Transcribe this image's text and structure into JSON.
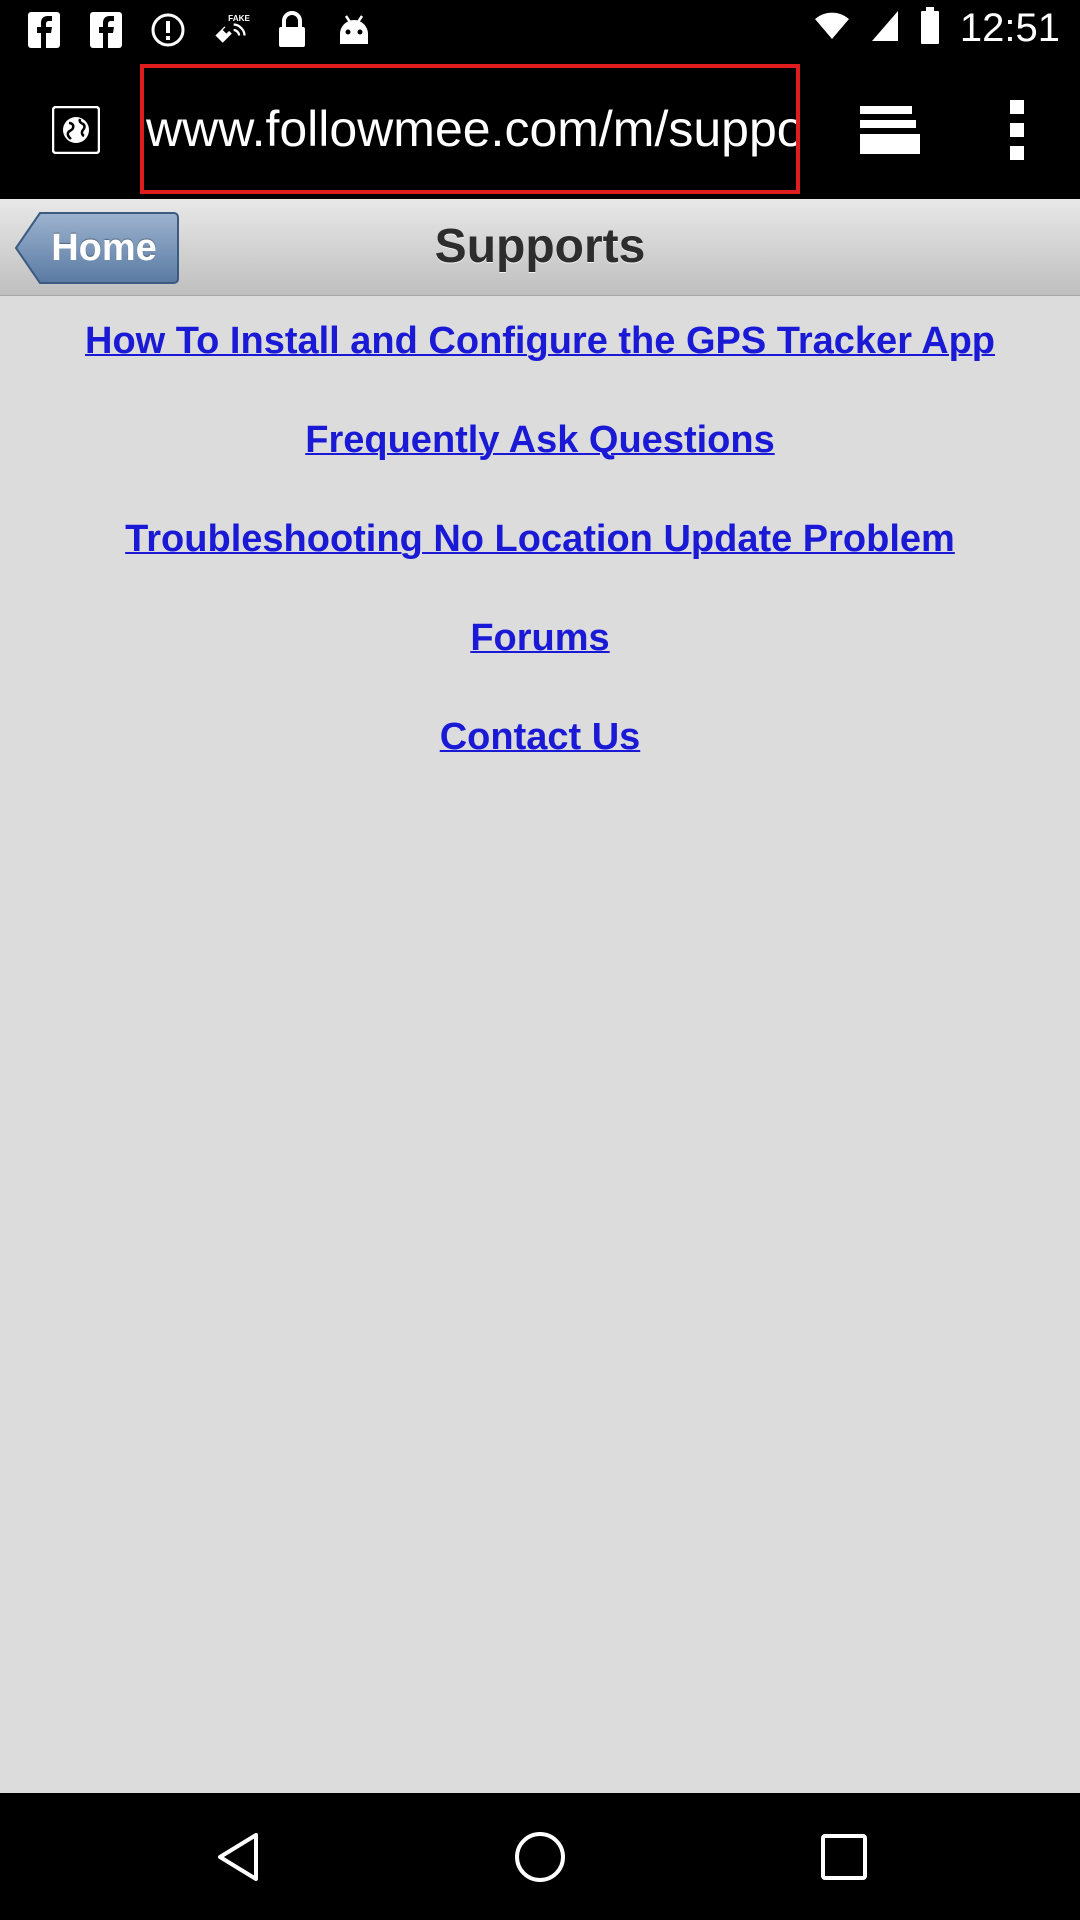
{
  "status_bar": {
    "time": "12:51",
    "left_icons": [
      "facebook-icon",
      "facebook-icon",
      "alert-icon",
      "fake-gps-icon",
      "lock-icon",
      "android-icon"
    ],
    "right_icons": [
      "wifi-icon",
      "signal-icon",
      "battery-icon"
    ]
  },
  "browser": {
    "url": "www.followmee.com/m/suppor"
  },
  "header": {
    "home_label": "Home",
    "title": "Supports"
  },
  "links": [
    "How To Install and Configure the GPS Tracker App",
    "Frequently Ask Questions",
    "Troubleshooting No Location Update Problem",
    "Forums",
    "Contact Us"
  ],
  "colors": {
    "link": "#1a1ad6",
    "highlight_border": "#e01d1d",
    "page_bg": "#dcdcdd"
  }
}
